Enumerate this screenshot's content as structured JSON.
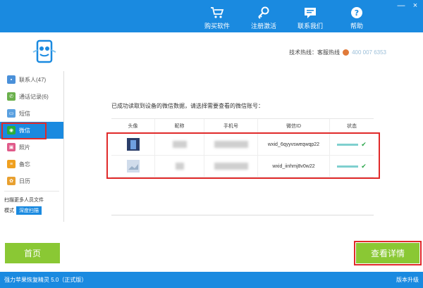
{
  "colors": {
    "brand_blue": "#1a8ae0",
    "accent_green": "#8ac834",
    "highlight_red": "#e02a2a"
  },
  "window_controls": {
    "minimize": "—",
    "close": "×"
  },
  "nav": [
    {
      "icon": "cart-icon",
      "label": "购买软件"
    },
    {
      "icon": "key-icon",
      "label": "注册激活"
    },
    {
      "icon": "chat-icon",
      "label": "联系我们"
    },
    {
      "icon": "help-icon",
      "label": "帮助"
    }
  ],
  "support": {
    "label": "技术热线：客服热线",
    "phone": "400 007 6353"
  },
  "sidebar": {
    "items": [
      {
        "icon": "contacts-icon",
        "label": "联系人(47)"
      },
      {
        "icon": "phone-icon",
        "label": "通话记录(6)"
      },
      {
        "icon": "sms-icon",
        "label": "短信"
      },
      {
        "icon": "wechat-icon",
        "label": "微信"
      },
      {
        "icon": "photo-icon",
        "label": "照片"
      },
      {
        "icon": "notes-icon",
        "label": "备忘"
      },
      {
        "icon": "apps-icon",
        "label": "日历"
      }
    ],
    "footer_label": "扫描更多人员文件",
    "mode_label": "模式",
    "mode_button": "深度扫描"
  },
  "content": {
    "instruction": "已成功读取到设备的微信数据，请选择需要查看的微信账号：",
    "columns": [
      "头像",
      "昵称",
      "手机号",
      "微信ID",
      "状态"
    ],
    "rows": [
      {
        "wechat_id": "wxid_6qyyvsweqwqp22"
      },
      {
        "wechat_id": "wxid_iinhmj8v0w22"
      }
    ]
  },
  "buttons": {
    "home": "首页",
    "detail": "查看详情"
  },
  "footer": {
    "left": "强力苹果恢复精灵 5.0（正式版）",
    "right": "版本升级"
  }
}
